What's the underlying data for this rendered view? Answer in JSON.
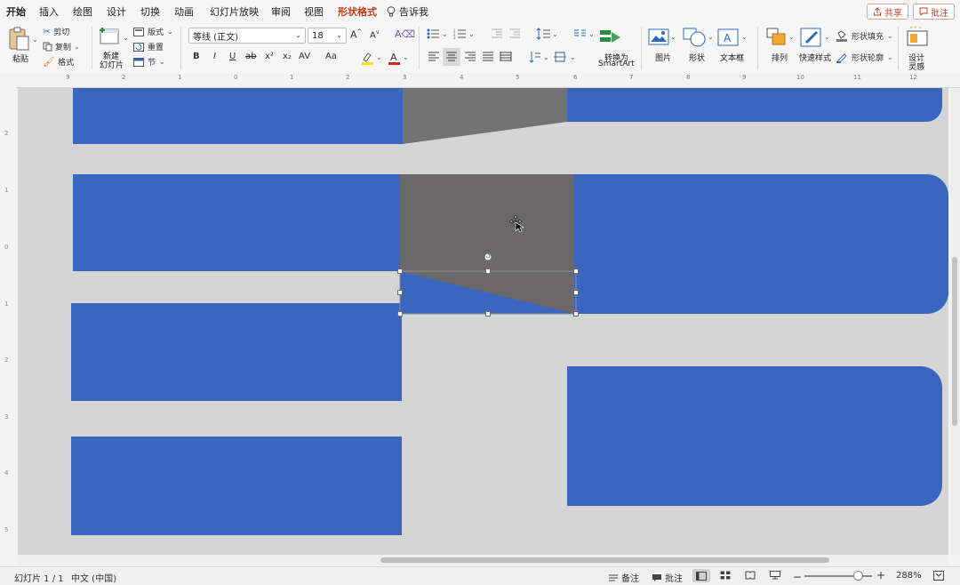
{
  "tabs": [
    {
      "label": "开始",
      "active": true
    },
    {
      "label": "插入"
    },
    {
      "label": "绘图"
    },
    {
      "label": "设计"
    },
    {
      "label": "切换"
    },
    {
      "label": "动画"
    },
    {
      "label": "幻灯片放映"
    },
    {
      "label": "审阅"
    },
    {
      "label": "视图"
    },
    {
      "label": "形状格式",
      "special": true
    },
    {
      "label": "告诉我",
      "icon": "lightbulb-icon"
    }
  ],
  "top_buttons": {
    "share": "共享",
    "comment": "批注"
  },
  "ribbon": {
    "clipboard": {
      "paste": "粘贴",
      "cut": "剪切",
      "copy": "复制",
      "format": "格式"
    },
    "slides": {
      "new_slide_line1": "新建",
      "new_slide_line2": "幻灯片",
      "layout": "版式",
      "reset": "重置",
      "section": "节"
    },
    "font": {
      "font_name": "等线 (正文)",
      "font_size": "18"
    },
    "convert": {
      "line1": "转换为",
      "line2": "SmartArt"
    },
    "insert": {
      "picture": "图片",
      "shape": "形状",
      "textbox": "文本框"
    },
    "arrange": {
      "arrange": "排列",
      "quick_styles": "快速样式",
      "shape_fill": "形状填充",
      "shape_outline": "形状轮廓"
    },
    "designer": {
      "line1": "设计",
      "line2": "灵感"
    },
    "font_format_buttons": [
      "B",
      "I",
      "U",
      "ab",
      "x²",
      "x₂",
      "AV",
      "Aa"
    ]
  },
  "ruler_numbers": [
    "3",
    "2",
    "1",
    "0",
    "1",
    "2",
    "3",
    "4",
    "5",
    "6",
    "7",
    "8",
    "9",
    "10",
    "11",
    "12"
  ],
  "vruler_numbers": [
    "2",
    "1",
    "0",
    "1",
    "2",
    "3",
    "4",
    "5"
  ],
  "colors": {
    "accent": "#c43e1c",
    "shape_blue": "#3b66bf",
    "shape_gray": "#6a6869",
    "shape_gray_light": "#737373",
    "canvas": "#d5d5d5"
  },
  "status": {
    "slide_info": "幻灯片 1 / 1",
    "language": "中文 (中国)",
    "notes": "备注",
    "comments": "批注",
    "zoom": "288%"
  }
}
